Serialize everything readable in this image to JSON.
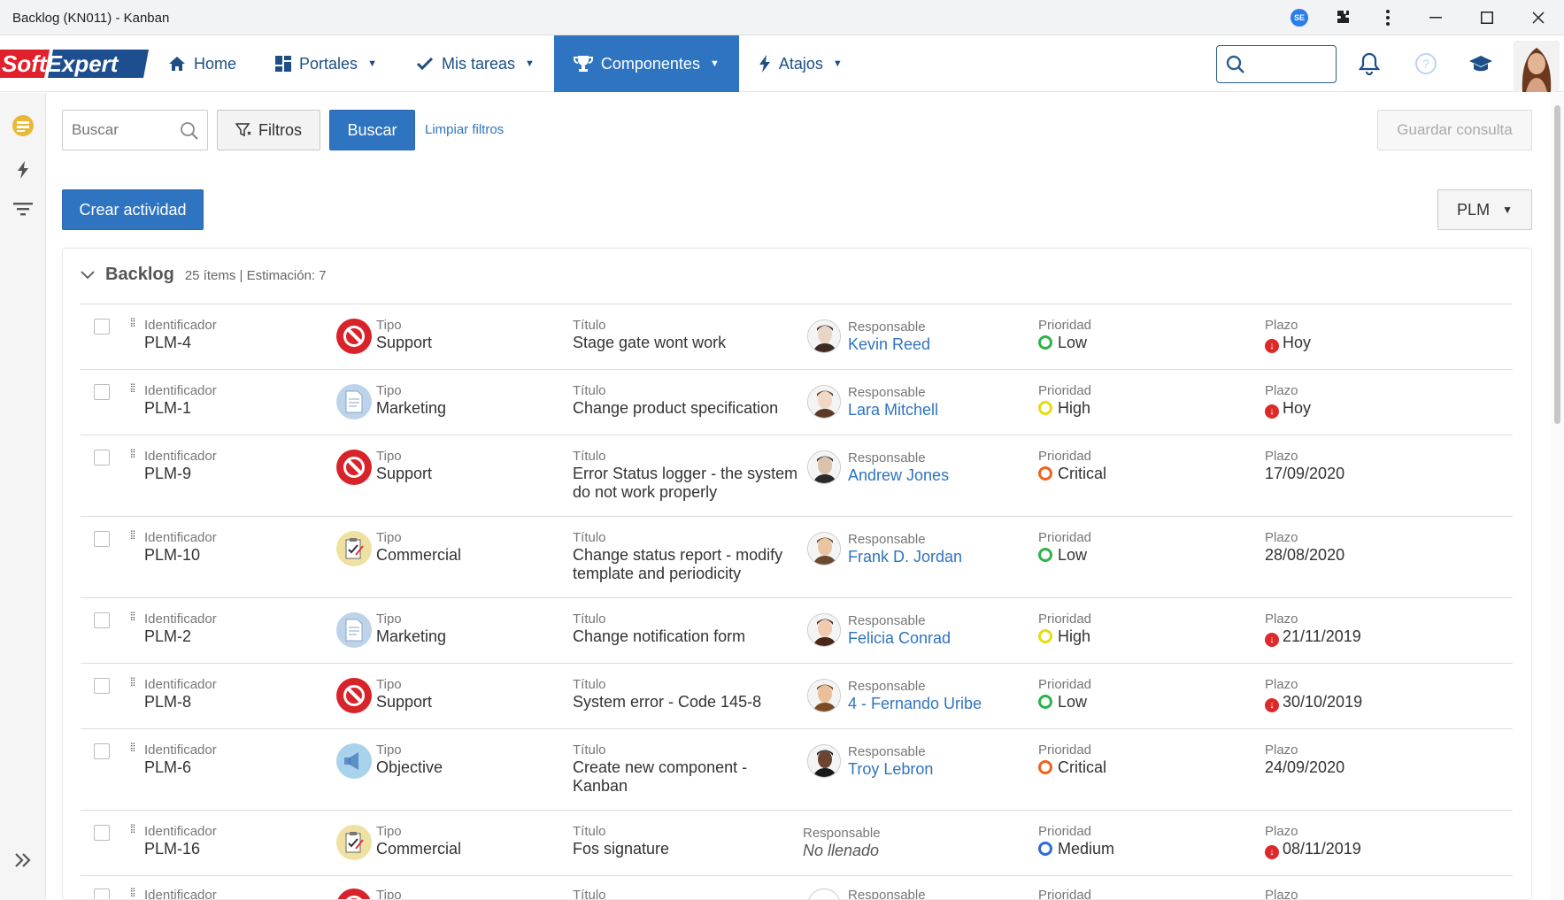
{
  "window": {
    "title": "Backlog (KN011) - Kanban",
    "ext_badge": "SE"
  },
  "nav": {
    "logo": "SoftExpert",
    "items": [
      {
        "label": "Home",
        "icon": "home-icon"
      },
      {
        "label": "Portales",
        "icon": "dashboard-icon",
        "has_caret": true
      },
      {
        "label": "Mis tareas",
        "icon": "check-icon",
        "has_caret": true
      },
      {
        "label": "Componentes",
        "icon": "trophy-icon",
        "has_caret": true,
        "active": true
      },
      {
        "label": "Atajos",
        "icon": "lightning-icon",
        "has_caret": true
      }
    ],
    "help_glyph": "?"
  },
  "toolbar": {
    "search_placeholder": "Buscar",
    "filter_label": "Filtros",
    "search_button": "Buscar",
    "clear_filters": "Limpiar filtros",
    "save_query": "Guardar consulta",
    "create_activity": "Crear actividad",
    "project_select": "PLM"
  },
  "backlog": {
    "title": "Backlog",
    "meta": "25 ítems | Estimación: 7",
    "labels": {
      "id": "Identificador",
      "type": "Tipo",
      "title": "Título",
      "owner": "Responsable",
      "priority": "Prioridad",
      "deadline": "Plazo"
    },
    "rows": [
      {
        "id": "PLM-4",
        "type": "Support",
        "type_icon": "support",
        "title": [
          "Stage gate wont work"
        ],
        "owner": "Kevin Reed",
        "owner_avatar": "m1",
        "priority": "Low",
        "priority_color": "#2db34a",
        "deadline": "Hoy",
        "overdue": true
      },
      {
        "id": "PLM-1",
        "type": "Marketing",
        "type_icon": "marketing",
        "title": [
          "Change product specification"
        ],
        "owner": "Lara Mitchell",
        "owner_avatar": "f1",
        "priority": "High",
        "priority_color": "#e4dd12",
        "deadline": "Hoy",
        "overdue": true
      },
      {
        "id": "PLM-9",
        "type": "Support",
        "type_icon": "support",
        "title": [
          "Error Status logger - the system",
          "do not work properly"
        ],
        "owner": "Andrew Jones",
        "owner_avatar": "m2",
        "priority": "Critical",
        "priority_color": "#f0621e",
        "deadline": "17/09/2020",
        "overdue": false
      },
      {
        "id": "PLM-10",
        "type": "Commercial",
        "type_icon": "commercial",
        "title": [
          "Change status report - modify",
          "template and periodicity"
        ],
        "owner": "Frank D. Jordan",
        "owner_avatar": "m3",
        "priority": "Low",
        "priority_color": "#2db34a",
        "deadline": "28/08/2020",
        "overdue": false
      },
      {
        "id": "PLM-2",
        "type": "Marketing",
        "type_icon": "marketing",
        "title": [
          "Change notification form"
        ],
        "owner": "Felicia Conrad",
        "owner_avatar": "f2",
        "priority": "High",
        "priority_color": "#e4dd12",
        "deadline": "21/11/2019",
        "overdue": true
      },
      {
        "id": "PLM-8",
        "type": "Support",
        "type_icon": "support",
        "title": [
          "System error - Code 145-8"
        ],
        "owner": "4 - Fernando Uribe",
        "owner_avatar": "m4",
        "priority": "Low",
        "priority_color": "#2db34a",
        "deadline": "30/10/2019",
        "overdue": true
      },
      {
        "id": "PLM-6",
        "type": "Objective",
        "type_icon": "objective",
        "title": [
          "Create new component -",
          "Kanban"
        ],
        "owner": "Troy Lebron",
        "owner_avatar": "m5",
        "priority": "Critical",
        "priority_color": "#f0621e",
        "deadline": "24/09/2020",
        "overdue": false
      },
      {
        "id": "PLM-16",
        "type": "Commercial",
        "type_icon": "commercial",
        "title": [
          "Fos signature"
        ],
        "owner": "No llenado",
        "owner_avatar": "",
        "priority": "Medium",
        "priority_color": "#2f6fd1",
        "deadline": "08/11/2019",
        "overdue": true
      }
    ],
    "partial_row_labels": true
  }
}
